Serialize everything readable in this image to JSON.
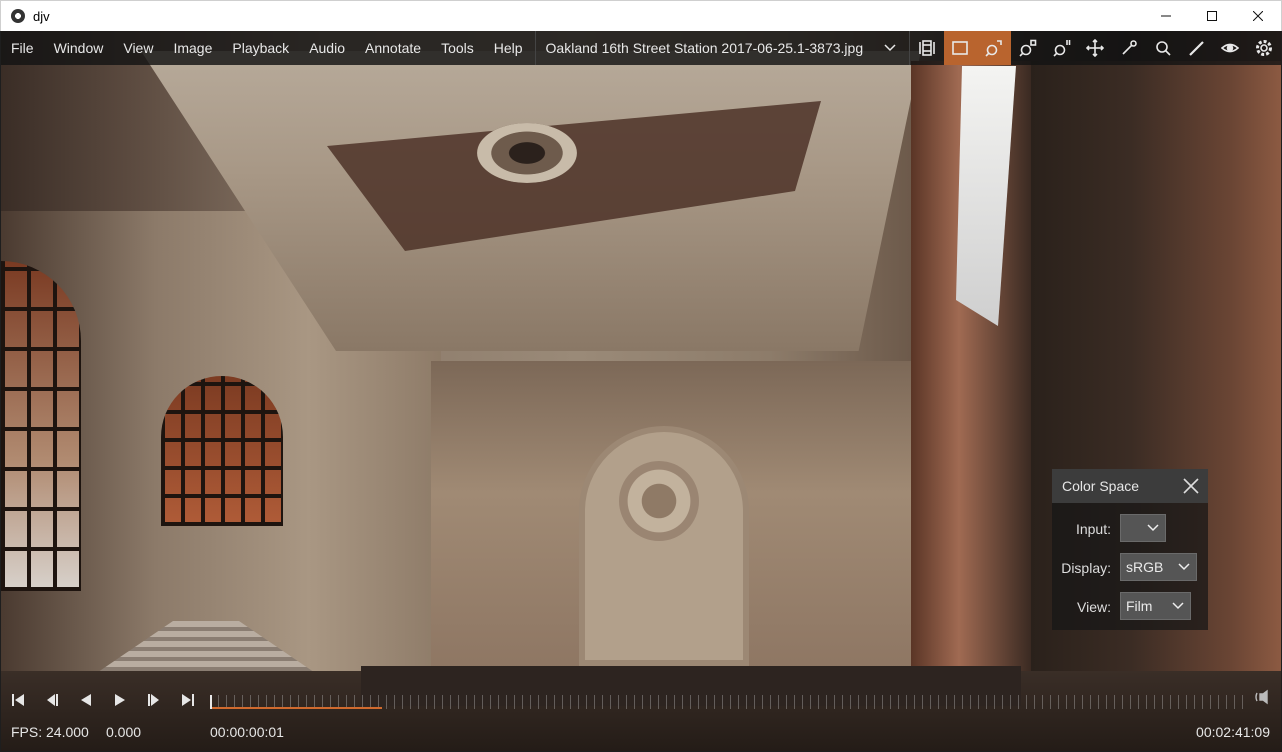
{
  "window": {
    "title": "djv"
  },
  "menu": [
    "File",
    "Window",
    "View",
    "Image",
    "Playback",
    "Audio",
    "Annotate",
    "Tools",
    "Help"
  ],
  "file": {
    "name": "Oakland 16th Street Station 2017-06-25.1-3873.jpg"
  },
  "toolbar": [
    {
      "name": "frame-view-icon",
      "active": false
    },
    {
      "name": "fill-frame-icon",
      "active": true
    },
    {
      "name": "zoom-fit-icon",
      "active": true
    },
    {
      "name": "zoom-in-icon",
      "active": false
    },
    {
      "name": "zoom-reset-icon",
      "active": false
    },
    {
      "name": "pan-icon",
      "active": false
    },
    {
      "name": "color-picker-icon",
      "active": false
    },
    {
      "name": "magnify-icon",
      "active": false
    },
    {
      "name": "annotate-pen-icon",
      "active": false
    },
    {
      "name": "eye-icon",
      "active": false
    },
    {
      "name": "settings-gear-icon",
      "active": false
    }
  ],
  "color_space": {
    "title": "Color Space",
    "input": {
      "label": "Input:",
      "value": ""
    },
    "display": {
      "label": "Display:",
      "value": "sRGB"
    },
    "view": {
      "label": "View:",
      "value": "Film"
    }
  },
  "playback": {
    "progress": 0.165,
    "fps": "FPS: 24.000",
    "speed": "0.000",
    "current_time": "00:00:00:01",
    "duration": "00:02:41:09"
  },
  "colors": {
    "accent": "#d06a2e",
    "active_tool": "#b9642e"
  }
}
